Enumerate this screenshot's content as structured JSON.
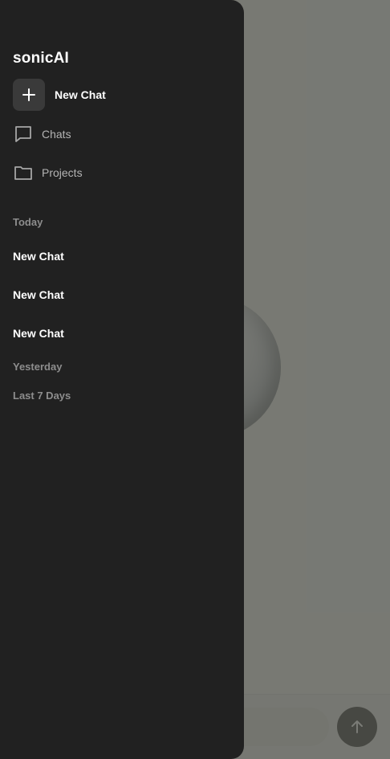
{
  "app": {
    "brand": "sonicAI"
  },
  "sidebar": {
    "new_chat_label": "New Chat",
    "nav": [
      {
        "label": "Chats",
        "icon": "chat-bubble-icon"
      },
      {
        "label": "Projects",
        "icon": "folder-icon"
      }
    ],
    "sections": {
      "today": {
        "label": "Today",
        "items": [
          {
            "label": "New Chat"
          },
          {
            "label": "New Chat"
          },
          {
            "label": "New Chat"
          }
        ]
      },
      "yesterday": {
        "label": "Yesterday"
      },
      "last7": {
        "label": "Last 7 Days"
      }
    }
  },
  "composer": {
    "send_icon": "arrow-up-icon"
  },
  "colors": {
    "drawer_bg": "#212121",
    "scrim": "#545650",
    "send_button": "#1a1a1a"
  }
}
